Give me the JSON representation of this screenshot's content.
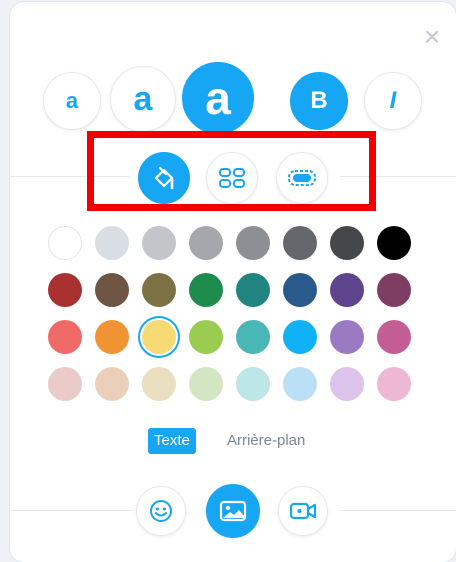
{
  "close_label": "×",
  "size_buttons": [
    {
      "label": "a",
      "active": false
    },
    {
      "label": "a",
      "active": false
    },
    {
      "label": "a",
      "active": true
    }
  ],
  "style_buttons": [
    {
      "label": "B",
      "active": true
    },
    {
      "label": "I",
      "active": false
    }
  ],
  "mode_buttons": [
    {
      "icon": "paint-bucket-icon",
      "active": true
    },
    {
      "icon": "shapes-icon",
      "active": false
    },
    {
      "icon": "dashed-rounded-rect-icon",
      "active": false
    }
  ],
  "highlight_color": "#f20000",
  "accent_color": "#16a6f4",
  "palette_rows": [
    [
      "#ffffff",
      "#d9dee4",
      "#c2c6cb",
      "#a4a7ab",
      "#8c8f93",
      "#64676b",
      "#45484b",
      "#000000"
    ],
    [
      "#a93230",
      "#6f5544",
      "#7d7245",
      "#1e8c4c",
      "#208580",
      "#2a5a8c",
      "#5d448c",
      "#7e3d63"
    ],
    [
      "#f06b67",
      "#f09433",
      "#f8da74",
      "#9bcc52",
      "#4ab7b7",
      "#11b1f6",
      "#9b7ac4",
      "#c45d93"
    ],
    [
      "#ebcaca",
      "#ead0bb",
      "#e9dec0",
      "#d3e6c3",
      "#bde6e6",
      "#bbe0f5",
      "#dbc3eb",
      "#eeb7d3"
    ]
  ],
  "selected_color": "#f8da74",
  "tabs": {
    "text": "Texte",
    "background": "Arrière-plan"
  },
  "media_buttons": [
    {
      "icon": "smiley-icon",
      "active": false
    },
    {
      "icon": "image-icon",
      "active": true
    },
    {
      "icon": "video-camera-icon",
      "active": false
    }
  ]
}
